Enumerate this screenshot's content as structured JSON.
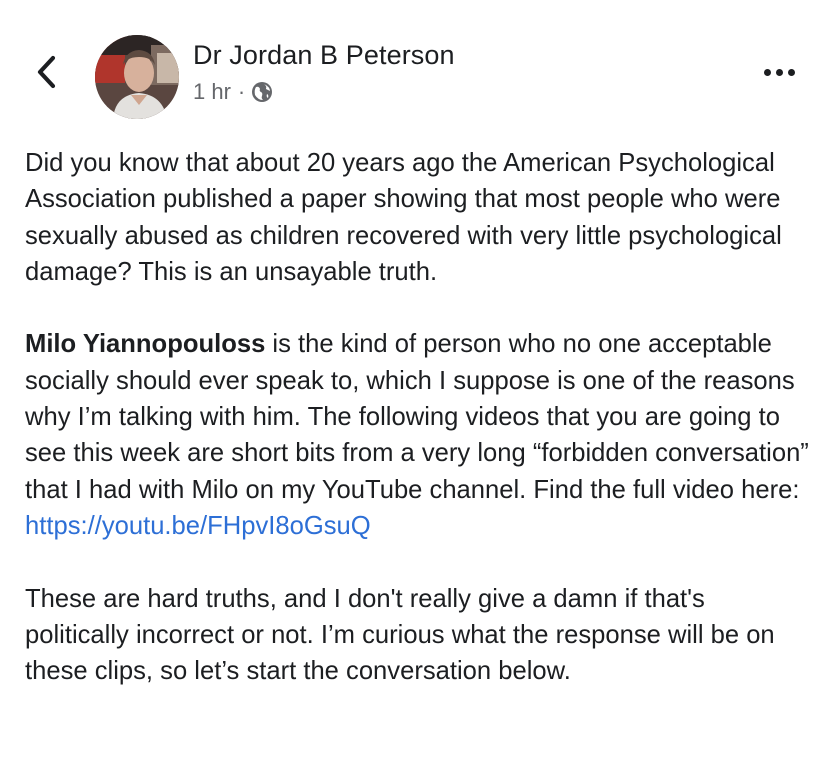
{
  "header": {
    "back_icon": "chevron-left-icon",
    "author_name": "Dr Jordan B Peterson",
    "timestamp": "1 hr",
    "separator": "·",
    "audience_icon": "globe-icon",
    "more_icon": "more-horizontal-icon"
  },
  "post": {
    "paragraph1": "Did you know that about 20 years ago the American Psychological Association published a paper showing that most people who were sexually abused as children recovered with very little psychological damage? This is an unsayable truth.",
    "paragraph2_mention": "Milo Yiannopouloss",
    "paragraph2_text": " is the kind of person who no one acceptable socially should ever speak to, which I suppose is one of the reasons why I’m talking with him. The following videos that you are going to see this week are short bits from a very long “forbidden conversation” that I had with Milo on my YouTube channel. Find the full video here:",
    "paragraph2_link": "https://youtu.be/FHpvI8oGsuQ",
    "paragraph3": "These are hard truths, and I don't really give a damn if that's politically incorrect or not. I’m curious what the response will be on these clips, so let’s start the conversation below."
  },
  "colors": {
    "text": "#1c1e21",
    "secondary_text": "#65676b",
    "link": "#2d6fd6",
    "background": "#ffffff"
  }
}
